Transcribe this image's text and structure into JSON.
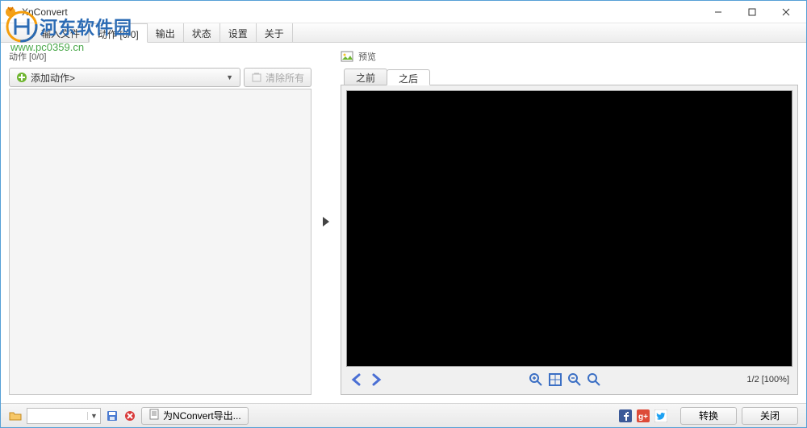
{
  "window": {
    "title": "XnConvert"
  },
  "watermark": {
    "text": "河东软件园",
    "url": "www.pc0359.cn"
  },
  "tabs": {
    "items": [
      {
        "label": "输入文件"
      },
      {
        "label": "动作 [0/0]"
      },
      {
        "label": "输出"
      },
      {
        "label": "状态"
      },
      {
        "label": "设置"
      },
      {
        "label": "关于"
      }
    ],
    "active_index": 1
  },
  "left": {
    "header": "动作 [0/0]",
    "add_action": "添加动作>",
    "clear_all": "清除所有"
  },
  "preview": {
    "header": "预览",
    "tab_before": "之前",
    "tab_after": "之后",
    "counter": "1/2 [100%]"
  },
  "bottom": {
    "export_label": "为NConvert导出...",
    "convert": "转换",
    "close": "关闭"
  }
}
